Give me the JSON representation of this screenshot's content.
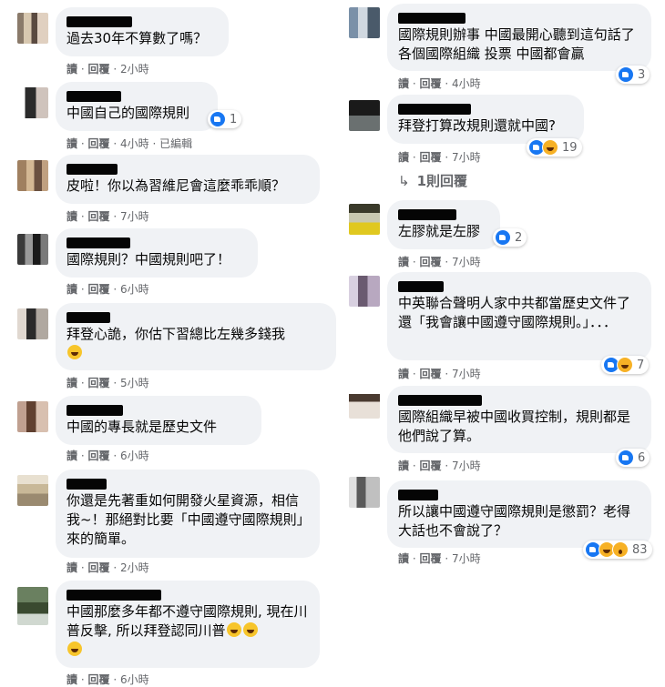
{
  "action_reply": "回覆",
  "action_like": "讀",
  "edited_label": "已編輯",
  "left": [
    {
      "text": "過去30年不算數了嗎？",
      "time": "2小時"
    },
    {
      "text": "中國自己的國際規則",
      "time": "4小時",
      "reaction_count": "1"
    },
    {
      "text": "皮啦！你以為習維尼會這麼乖乖順？",
      "time": "7小時"
    },
    {
      "text": "國際規則？中國規則吧了！",
      "time": "6小時"
    },
    {
      "text": "拜登心詭，你估下習總比左幾多錢我",
      "time": "5小時",
      "emoji_count": 1
    },
    {
      "text": "中國的專長就是歷史文件",
      "time": "6小時"
    },
    {
      "text": "你還是先著重如何開發火星資源，相信我~！那絕對比要「中國遵守國際規則」來的簡單。",
      "time": "2小時"
    },
    {
      "text": "中國那麼多年都不遵守國際規則, 現在川普反擊, 所以拜登認同川普",
      "time": "6小時",
      "emoji_count": 3
    }
  ],
  "right": [
    {
      "text": "國際規則辦事 中國最開心聽到這句話了 各個國際組織 投票 中國都會贏",
      "time": "4小時",
      "reaction_count": "3"
    },
    {
      "text": "拜登打算改規則還就中國?",
      "time": "7小時",
      "reaction_count": "19"
    },
    {
      "text": "左膠就是左膠",
      "time": "7小時",
      "reaction_count": "2"
    },
    {
      "text": "中英聯合聲明人家中共都當歷史文件了還「我會讓中國遵守國際規則。」．．．",
      "time": "7小時",
      "reaction_count": "7"
    },
    {
      "text": "國際組織早被中國收買控制，規則都是他們說了算。",
      "time": "7小時",
      "reaction_count": "6"
    },
    {
      "text": "所以讓中國遵守國際規則是懲罰？老得大話也不會說了？",
      "time": "7小時",
      "reaction_count": "83"
    }
  ],
  "replies_label": "1則回覆",
  "separator": "·"
}
